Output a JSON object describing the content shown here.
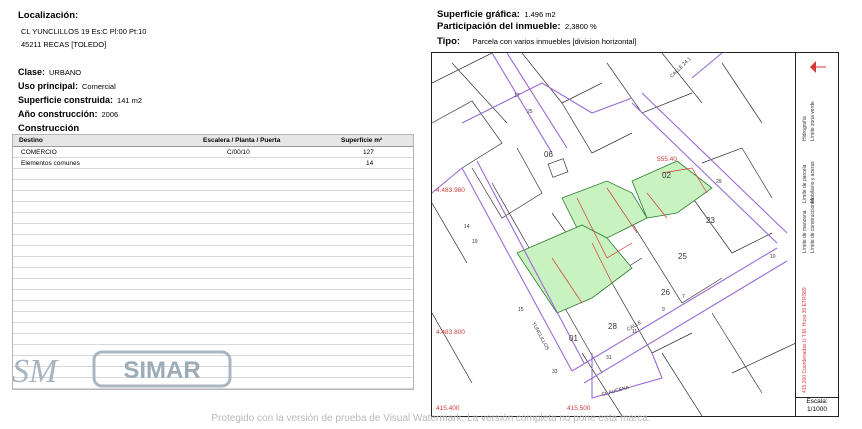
{
  "left": {
    "localizacion_label": "Localización:",
    "address_line1": "CL YUNCLILLOS 19 Es:C Pl:00 Pt:10",
    "address_line2": "45211 RECAS [TOLEDO]",
    "clase_label": "Clase:",
    "clase_value": "URBANO",
    "uso_label": "Uso principal:",
    "uso_value": "Comercial",
    "sup_cons_label": "Superficie construida:",
    "sup_cons_value": "141 m2",
    "anio_label": "Año construcción:",
    "anio_value": "2006",
    "construccion_title": "Construcción",
    "table": {
      "headers": [
        "Destino",
        "Escalera / Planta / Puerta",
        "Superficie m²"
      ],
      "rows": [
        [
          "COMERCIO",
          "C/00/10",
          "127"
        ],
        [
          "Elementos comunes",
          "",
          "14"
        ]
      ]
    }
  },
  "right": {
    "sup_graf_label": "Superficie gráfica:",
    "sup_graf_value": "1.496 m2",
    "participacion_label": "Participación del inmueble:",
    "participacion_value": "2,3800 %",
    "tipo_label": "Tipo:",
    "tipo_value": "Parcela con varios inmuebles [division horizontal]"
  },
  "map": {
    "parcel_numbers": [
      "06",
      "02",
      "23",
      "25",
      "26",
      "28",
      "01"
    ],
    "coord_labels": [
      "4.483.960",
      "4.483.800",
      "415.400",
      "415.500",
      "555.40"
    ],
    "street_labels": [
      "YUNCLILLOS",
      "CALLE",
      "CL AUCENA",
      "CALLE 24.1"
    ],
    "small_numbers": [
      "17",
      "25",
      "19",
      "29",
      "10",
      "7",
      "9",
      "11",
      "15",
      "33",
      "31",
      "14"
    ],
    "legend_items": [
      "Límite de manzana",
      "Límite de parcela",
      "Límite de construcciones",
      "Mobiliario y aceras",
      "Límite zona verde",
      "Hidrografía"
    ],
    "legend_coord_text": "415.200 Coordenadas U.T.M. Huso 30 ETRS89",
    "escala_label": "Escala:",
    "escala_value": "1/1000",
    "colors": {
      "green_fill": "#c8f2c0",
      "street_line": "#9a6ad8",
      "red_line": "#d43a3a"
    }
  },
  "logo": {
    "text": "SIMAR",
    "mark": "SM"
  },
  "watermark": "Protegido con la versión de prueba de Visual Watermark. La versión completa no pone esta marca."
}
